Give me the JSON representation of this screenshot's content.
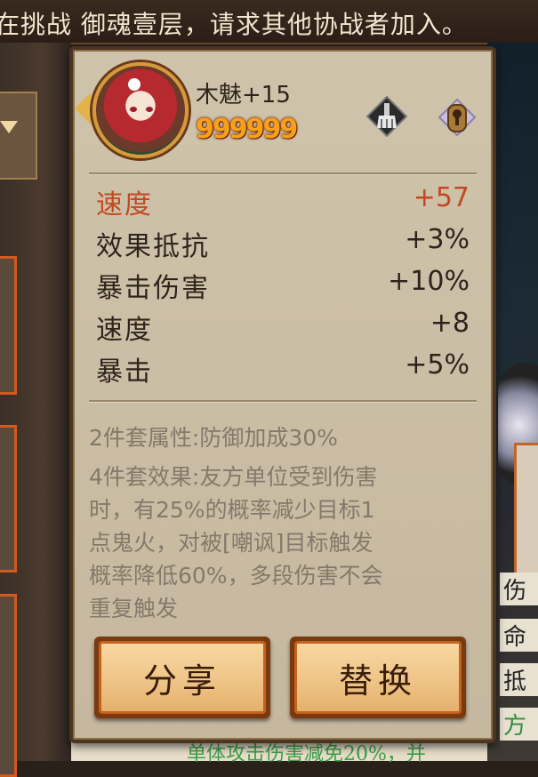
{
  "banner": {
    "text": "在挑战 御魂壹层，请求其他协战者加入。"
  },
  "soul": {
    "name": "木魅+15",
    "level_stars": "999999",
    "main_stat": {
      "label": "速度",
      "value": "+57"
    },
    "sub_stats": [
      {
        "label": "效果抵抗",
        "value": "+3%"
      },
      {
        "label": "暴击伤害",
        "value": "+10%"
      },
      {
        "label": "速度",
        "value": "+8"
      },
      {
        "label": "暴击",
        "value": "+5%"
      }
    ],
    "set2": "2件套属性:防御加成30%",
    "set4_lines": [
      "4件套效果:友方单位受到伤害",
      "时，有25%的概率减少目标1",
      "点鬼火，对被[嘲讽]目标触发",
      "概率降低60%，多段伤害不会",
      "重复触发"
    ]
  },
  "buttons": {
    "share": "分享",
    "replace": "替换"
  },
  "background": {
    "right_texts": [
      "伤",
      "命",
      "抵",
      "方"
    ],
    "bottom_text": "单体攻击伤害减免20%，并"
  },
  "icons": {
    "brush": "brush-icon",
    "lock": "lock-icon"
  },
  "colors": {
    "main_stat": "#c24a22",
    "stars": "#f6a11c",
    "button_border": "#c4621e"
  }
}
